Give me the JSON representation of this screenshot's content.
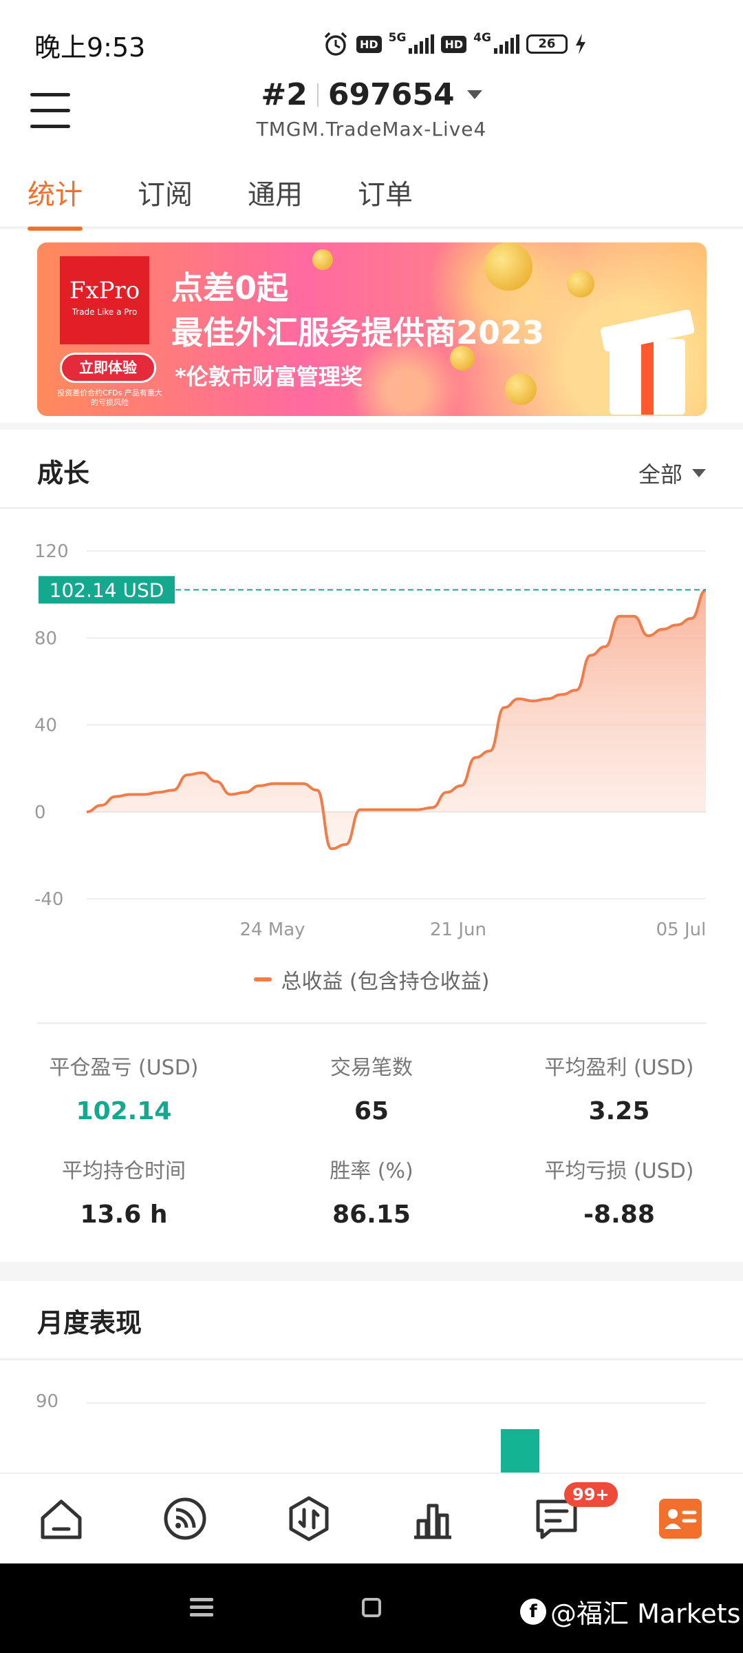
{
  "status_bar": {
    "time": "晚上9:53",
    "hd1": "HD",
    "net1": "5G",
    "hd2": "HD",
    "net2": "4G",
    "battery": "26"
  },
  "header": {
    "account_prefix": "#2",
    "account_number": "697654",
    "server": "TMGM.TradeMax-Live4"
  },
  "tabs": [
    {
      "label": "统计",
      "active": true
    },
    {
      "label": "订阅",
      "active": false
    },
    {
      "label": "通用",
      "active": false
    },
    {
      "label": "订单",
      "active": false
    }
  ],
  "banner": {
    "logo_name": "FxPro",
    "logo_tagline": "Trade Like a Pro",
    "line1": "点差0起",
    "line2": "最佳外汇服务提供商2023",
    "line3": "*伦敦市财富管理奖",
    "cta": "立即体验",
    "risk_note": "投资差价合约CFDs 产品有重大的亏损风险"
  },
  "growth": {
    "title": "成长",
    "range": "全部",
    "current_value_label": "102.14 USD",
    "legend": "总收益 (包含持仓收益)"
  },
  "chart_data": {
    "type": "area",
    "y_ticks": [
      "120",
      "80",
      "40",
      "0",
      "-40"
    ],
    "ylim": [
      -40,
      120
    ],
    "x_tick_labels": [
      "24 May",
      "21 Jun",
      "05 Jul"
    ],
    "reference_line": 102.14,
    "series": [
      {
        "name": "总收益 (包含持仓收益)",
        "color": "#f07c4a",
        "values": [
          0,
          3,
          7,
          8,
          8,
          9,
          10,
          17,
          18,
          14,
          8,
          9,
          12,
          13,
          13,
          13,
          10,
          -17,
          -15,
          1,
          1,
          1,
          1,
          1,
          2,
          9,
          12,
          25,
          28,
          48,
          52,
          51,
          52,
          54,
          56,
          72,
          76,
          90,
          90,
          81,
          84,
          86,
          89,
          102
        ]
      }
    ]
  },
  "stats": [
    {
      "label": "平仓盈亏 (USD)",
      "value": "102.14",
      "color": "#14a88f"
    },
    {
      "label": "交易笔数",
      "value": "65"
    },
    {
      "label": "平均盈利 (USD)",
      "value": "3.25"
    },
    {
      "label": "平均持仓时间",
      "value": "13.6 h"
    },
    {
      "label": "胜率 (%)",
      "value": "86.15"
    },
    {
      "label": "平均亏损 (USD)",
      "value": "-8.88"
    }
  ],
  "monthly": {
    "title": "月度表现",
    "y_tick_top": "90"
  },
  "bottom_nav": {
    "items": [
      "home-icon",
      "feed-icon",
      "trade-icon",
      "chart-icon",
      "message-icon",
      "profile-icon"
    ],
    "badge": "99+",
    "accent": "#f26f2c"
  },
  "system_nav": {
    "watermark": "@福汇 Markets"
  },
  "colors": {
    "accent": "#f26f2c",
    "positive": "#14a88f",
    "line": "#f07c4a"
  }
}
